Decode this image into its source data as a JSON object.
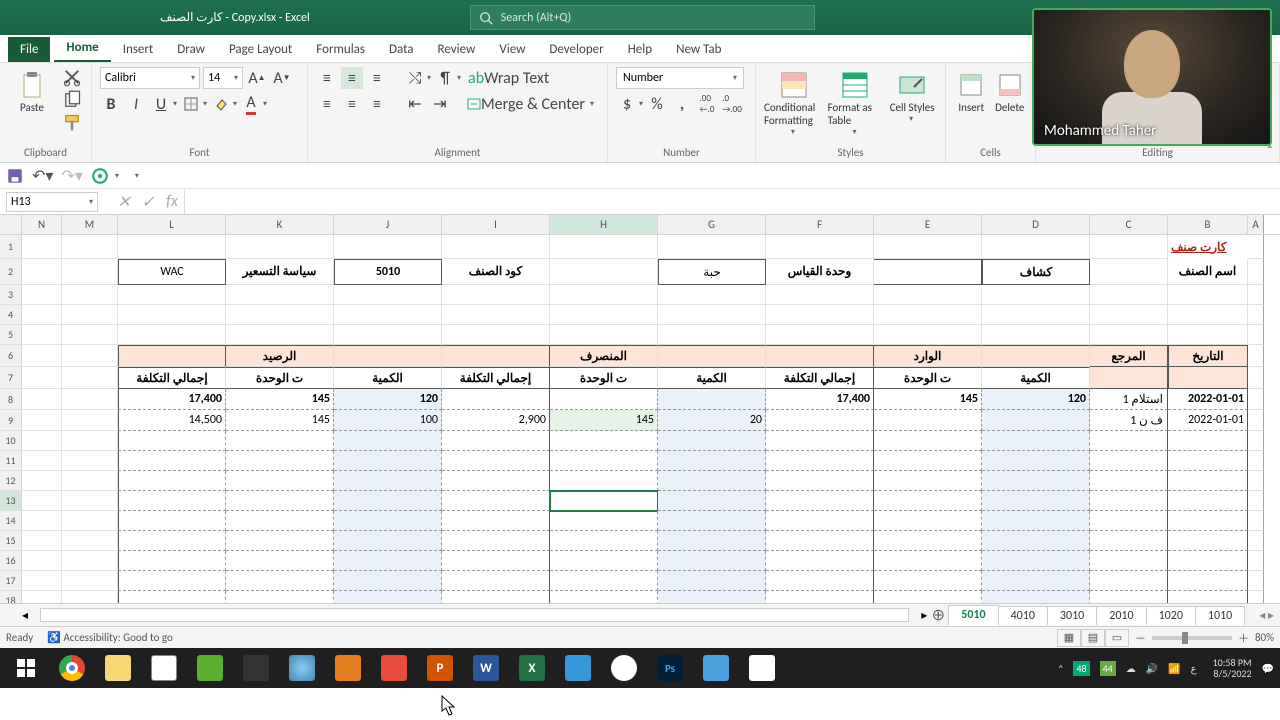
{
  "title": "كارت الصنف - Copy.xlsx  -  Excel",
  "search_placeholder": "Search (Alt+Q)",
  "webcam_label": "Mohammed Taher",
  "tabs": {
    "file": "File",
    "home": "Home",
    "insert": "Insert",
    "draw": "Draw",
    "page": "Page Layout",
    "formulas": "Formulas",
    "data": "Data",
    "review": "Review",
    "view": "View",
    "developer": "Developer",
    "help": "Help",
    "newtab": "New Tab"
  },
  "ribbon": {
    "clipboard": {
      "paste": "Paste",
      "label": "Clipboard"
    },
    "font": {
      "name": "Calibri",
      "size": "14",
      "label": "Font"
    },
    "alignment": {
      "wrap": "Wrap Text",
      "merge": "Merge & Center",
      "label": "Alignment"
    },
    "number": {
      "format": "Number",
      "label": "Number"
    },
    "styles": {
      "cond": "Conditional Formatting",
      "fmt": "Format as Table",
      "cell": "Cell Styles",
      "label": "Styles"
    },
    "cells": {
      "insert": "Insert",
      "delete": "Delete",
      "label": "Cells"
    },
    "editing": {
      "label": "Editing"
    }
  },
  "namebox": "H13",
  "cols": [
    "N",
    "M",
    "L",
    "K",
    "J",
    "I",
    "H",
    "G",
    "F",
    "E",
    "D",
    "C",
    "B",
    "A"
  ],
  "card": {
    "title": "كارت صنف",
    "item_name_lbl": "اسم الصنف",
    "item_name": "كشاف",
    "uom_lbl": "وحدة القياس",
    "uom": "حبة",
    "code_lbl": "كود الصنف",
    "code": "5010",
    "policy_lbl": "سياسة التسعير",
    "policy": "WAC",
    "headers": {
      "date": "التاريخ",
      "ref": "المرجع",
      "in": "الوارد",
      "out": "المنصرف",
      "bal": "الرصيد",
      "qty": "الكمية",
      "unit": "ت الوحدة",
      "total": "إجمالي التكلفة"
    },
    "rows": [
      {
        "date": "2022-01-01",
        "ref": "استلام 1",
        "in_qty": "120",
        "in_unit": "145",
        "in_total": "17,400",
        "out_qty": "",
        "out_unit": "",
        "out_total": "",
        "bal_qty": "120",
        "bal_unit": "145",
        "bal_total": "17,400"
      },
      {
        "date": "2022-01-01",
        "ref": "ف ن 1",
        "in_qty": "",
        "in_unit": "",
        "in_total": "",
        "out_qty": "20",
        "out_unit": "145",
        "out_total": "2,900",
        "bal_qty": "100",
        "bal_unit": "145",
        "bal_total": "14,500"
      }
    ]
  },
  "sheets": [
    "5010",
    "4010",
    "3010",
    "2010",
    "1020",
    "1010"
  ],
  "active_sheet": "5010",
  "status": {
    "ready": "Ready",
    "access": "Accessibility: Good to go",
    "zoom": "80%"
  },
  "clock": {
    "time": "10:58 PM",
    "date": "8/5/2022"
  }
}
